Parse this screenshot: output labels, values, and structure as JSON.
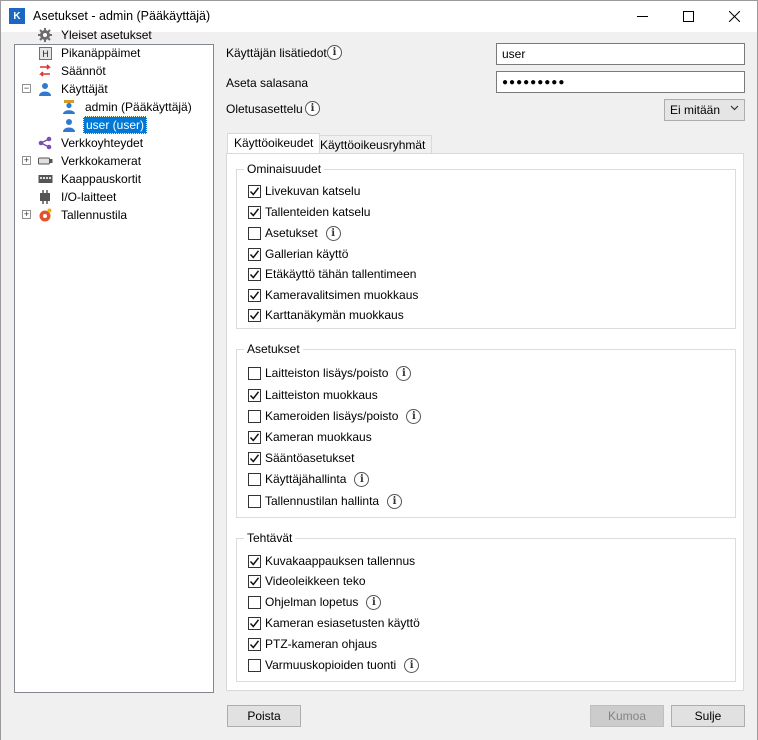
{
  "window": {
    "title": "Asetukset - admin (Pääkäyttäjä)",
    "app_icon_letter": "K"
  },
  "tree": [
    {
      "label": "Yleiset asetukset",
      "icon": "gear-icon"
    },
    {
      "label": "Pikanäppäimet",
      "icon": "keyboard-key-icon"
    },
    {
      "label": "Säännöt",
      "icon": "rules-icon"
    },
    {
      "label": "Käyttäjät",
      "icon": "user-icon",
      "expander": "−"
    },
    {
      "label": "admin (Pääkäyttäjä)",
      "icon": "admin-user-icon"
    },
    {
      "label": "user (user)",
      "icon": "user-icon",
      "selected": true
    },
    {
      "label": "Verkkoyhteydet",
      "icon": "network-icon"
    },
    {
      "label": "Verkkokamerat",
      "icon": "camera-icon",
      "expander": "+"
    },
    {
      "label": "Kaappauskortit",
      "icon": "capture-card-icon"
    },
    {
      "label": "I/O-laitteet",
      "icon": "io-device-icon"
    },
    {
      "label": "Tallennustila",
      "icon": "storage-icon",
      "expander": "+"
    }
  ],
  "form": {
    "user_info_label": "Käyttäjän lisätiedot",
    "username_value": "user",
    "password_label": "Aseta salasana",
    "password_value": "●●●●●●●●●",
    "default_layout_label": "Oletusasettelu",
    "default_layout_value": "Ei mitään"
  },
  "tabs": [
    {
      "label": "Käyttöoikeudet",
      "active": true
    },
    {
      "label": "Käyttöoikeusryhmät",
      "active": false
    }
  ],
  "groups": [
    {
      "title": "Ominaisuudet",
      "items": [
        {
          "label": "Livekuvan katselu",
          "checked": true,
          "info": false
        },
        {
          "label": "Tallenteiden katselu",
          "checked": true,
          "info": false
        },
        {
          "label": "Asetukset",
          "checked": false,
          "info": true
        },
        {
          "label": "Gallerian käyttö",
          "checked": true,
          "info": false
        },
        {
          "label": "Etäkäyttö tähän tallentimeen",
          "checked": true,
          "info": false
        },
        {
          "label": "Kameravalitsimen muokkaus",
          "checked": true,
          "info": false
        },
        {
          "label": "Karttanäkymän muokkaus",
          "checked": true,
          "info": false
        }
      ]
    },
    {
      "title": "Asetukset",
      "items": [
        {
          "label": "Laitteiston lisäys/poisto",
          "checked": false,
          "info": true
        },
        {
          "label": "Laitteiston muokkaus",
          "checked": true,
          "info": false
        },
        {
          "label": "Kameroiden lisäys/poisto",
          "checked": false,
          "info": true
        },
        {
          "label": "Kameran muokkaus",
          "checked": true,
          "info": false
        },
        {
          "label": "Sääntöasetukset",
          "checked": true,
          "info": false
        },
        {
          "label": "Käyttäjähallinta",
          "checked": false,
          "info": true
        },
        {
          "label": "Tallennustilan hallinta",
          "checked": false,
          "info": true
        }
      ]
    },
    {
      "title": "Tehtävät",
      "items": [
        {
          "label": "Kuvakaappauksen tallennus",
          "checked": true,
          "info": false
        },
        {
          "label": "Videoleikkeen teko",
          "checked": true,
          "info": false
        },
        {
          "label": "Ohjelman lopetus",
          "checked": false,
          "info": true
        },
        {
          "label": "Kameran esiasetusten käyttö",
          "checked": true,
          "info": false
        },
        {
          "label": "PTZ-kameran ohjaus",
          "checked": true,
          "info": false
        },
        {
          "label": "Varmuuskopioiden tuonti",
          "checked": false,
          "info": true
        }
      ]
    }
  ],
  "buttons": {
    "delete": "Poista",
    "undo": "Kumoa",
    "close": "Sulje"
  },
  "info_glyph": "i"
}
